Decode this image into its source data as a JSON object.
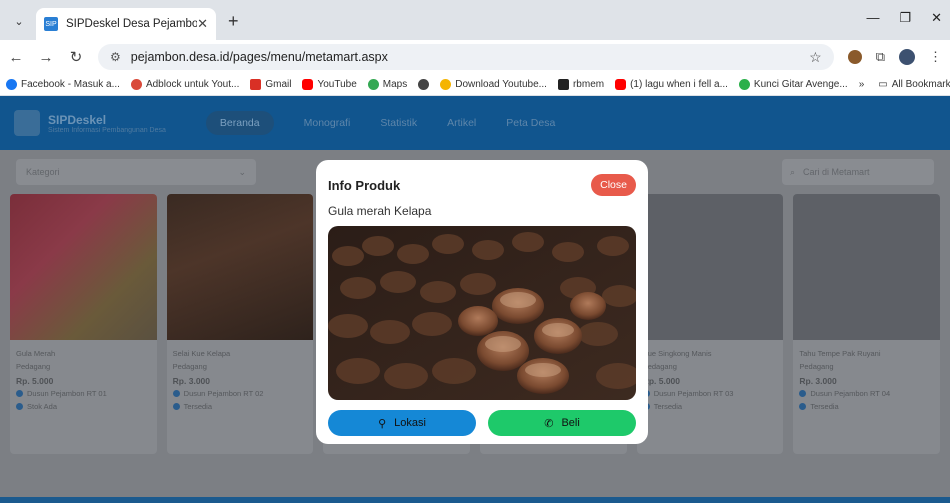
{
  "browser": {
    "tab_title": "SIPDeskel Desa Pejambon",
    "url": "pejambon.desa.id/pages/menu/metamart.aspx",
    "bookmarks": [
      {
        "label": "Facebook - Masuk a...",
        "color": "#1877f2"
      },
      {
        "label": "Adblock untuk Yout...",
        "color": "#d94a3a"
      },
      {
        "label": "Gmail",
        "color": "#d93025"
      },
      {
        "label": "YouTube",
        "color": "#ff0000"
      },
      {
        "label": "Maps",
        "color": "#34a853"
      },
      {
        "label": "",
        "color": "#444444"
      },
      {
        "label": "Download Youtube...",
        "color": "#f5b400"
      },
      {
        "label": "rbmem",
        "color": "#222222"
      },
      {
        "label": "(1) lagu when i fell a...",
        "color": "#ff0000"
      },
      {
        "label": "Kunci Gitar Avenge...",
        "color": "#2bb04a"
      }
    ],
    "more_bookmarks": "»",
    "all_bookmarks": "All Bookmarks"
  },
  "site": {
    "logo_title": "SIPDeskel",
    "logo_subtitle": "Sistem Informasi Pembangunan Desa",
    "menu": [
      "Beranda",
      "Monografi",
      "Statistik",
      "Artikel",
      "Peta Desa"
    ],
    "kategori_placeholder": "Kategori",
    "search_placeholder": "Cari di Metamart"
  },
  "cards": [
    {
      "name": "Gula Merah",
      "seller": "Pedagang",
      "price": "Rp. 5.000",
      "loc": "Dusun Pejambon RT 01",
      "status": "Stok Ada"
    },
    {
      "name": "Selai Kue Kelapa",
      "seller": "Pedagang",
      "price": "Rp. 3.000",
      "loc": "Dusun Pejambon RT 02",
      "status": "Tersedia"
    },
    {
      "name": "",
      "seller": "",
      "price": "",
      "loc": "",
      "status": ""
    },
    {
      "name": "",
      "seller": "",
      "price": "",
      "loc": "",
      "status": ""
    },
    {
      "name": "Kue Singkong Manis",
      "seller": "Pedagang",
      "price": "Rp. 5.000",
      "loc": "Dusun Pejambon RT 03",
      "status": "Tersedia"
    },
    {
      "name": "Tahu Tempe Pak Ruyani",
      "seller": "Pedagang",
      "price": "Rp. 3.000",
      "loc": "Dusun Pejambon RT 04",
      "status": "Tersedia"
    }
  ],
  "modal": {
    "title": "Info Produk",
    "close_label": "Close",
    "product_name": "Gula merah Kelapa",
    "lokasi_label": "Lokasi",
    "beli_label": "Beli"
  }
}
